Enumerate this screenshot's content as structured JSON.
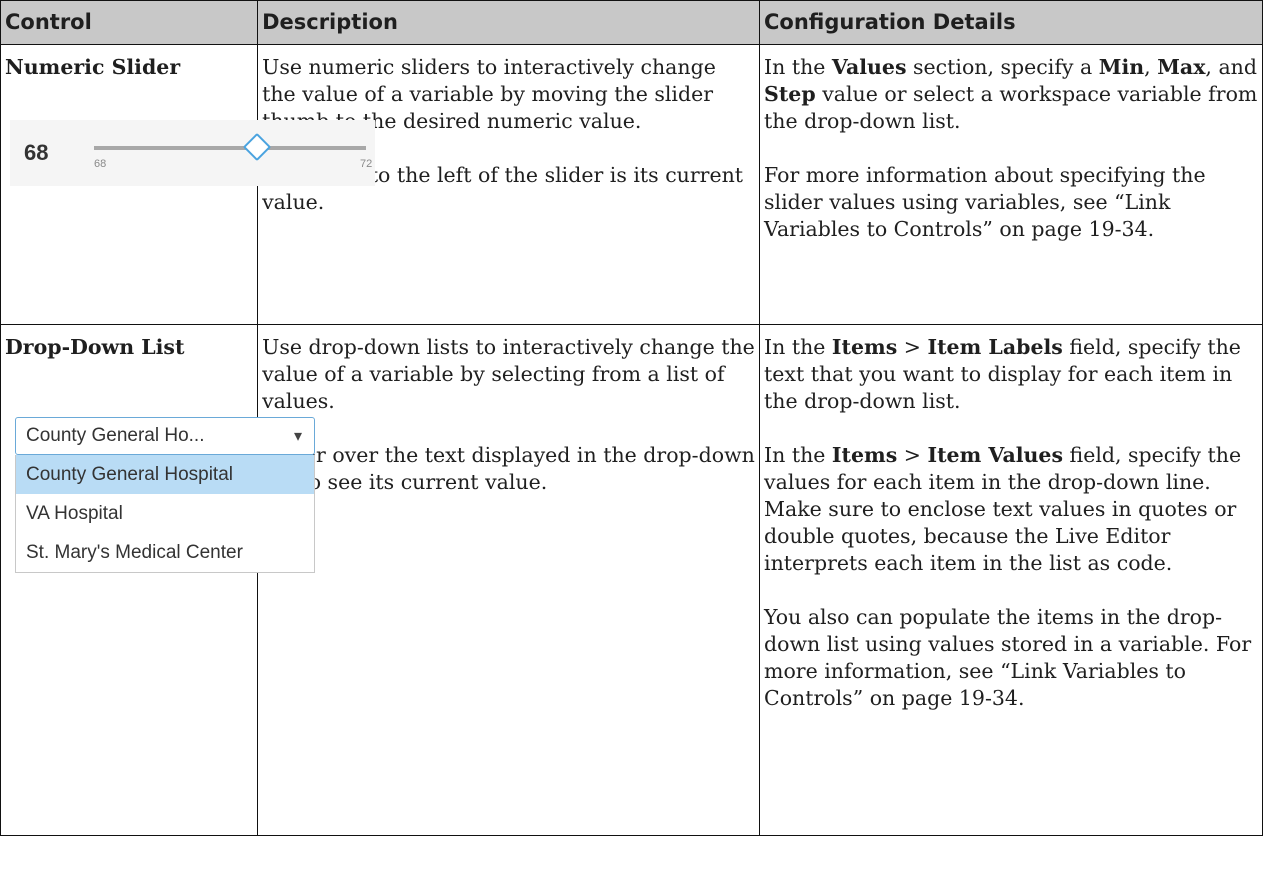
{
  "headers": [
    "Control",
    "Description",
    "Configuration Details"
  ],
  "rows": [
    {
      "control": "Numeric Slider",
      "description": [
        "Use numeric sliders to interactively change the value of a variable by moving the slider thumb to the desired numeric value.",
        "The value to the left of the slider is its current value."
      ],
      "config": [
        {
          "t1": "In the ",
          "b1": "Values",
          "t2": " section, specify a ",
          "b2": "Min",
          "t3": ", ",
          "b3": "Max",
          "t4": ", and ",
          "b4": "Step",
          "t5": " value or select a workspace variable from the drop-down list."
        },
        {
          "text": "For more information about specifying the slider values using variables, see “Link Variables to Controls” on page 19-34."
        }
      ]
    },
    {
      "control": "Drop-Down List",
      "description": [
        "Use drop-down lists to interactively change the value of a variable by selecting from a list of values.",
        "Hover over the text displayed in the drop-down list to see its current value."
      ],
      "config": [
        {
          "t1": "In the ",
          "b1": "Items",
          "t2": " > ",
          "b2": "Item Labels",
          "t3": " field, specify the text that you want to display for each item in the drop-down list."
        },
        {
          "t1": "In the ",
          "b1": "Items",
          "t2": " > ",
          "b2": "Item Values",
          "t3": " field, specify the values for each item in the drop-down line. Make sure to enclose text values in quotes or double quotes, because the Live Editor interprets each item in the list as code."
        },
        {
          "text": "You also can populate the items in the drop-down list using values stored in a variable. For more information, see “Link Variables to Controls” on page 19-34."
        }
      ]
    }
  ],
  "slider": {
    "current": "68",
    "min_label": "68",
    "max_label": "72",
    "value": 0.6
  },
  "dropdown": {
    "selected_label": "County General Ho...",
    "options": [
      "County General Hospital",
      "VA Hospital",
      "St. Mary's Medical Center"
    ],
    "highlighted_index": 0
  },
  "colors": {
    "header_bg": "#c8c8c8",
    "accent": "#4aa3df",
    "highlight": "#b9dcf5"
  }
}
